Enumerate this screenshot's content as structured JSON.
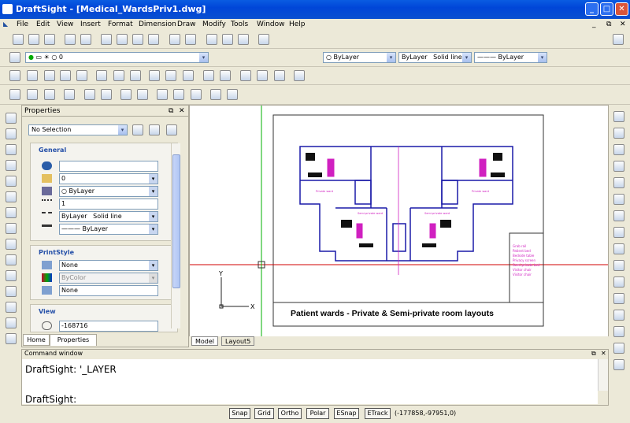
{
  "window": {
    "title": "DraftSight - [Medical_WardsPriv1.dwg]"
  },
  "menu": [
    "File",
    "Edit",
    "View",
    "Insert",
    "Format",
    "Dimension",
    "Draw",
    "Modify",
    "Tools",
    "Window",
    "Help"
  ],
  "layers_bar": {
    "layer_value": "0",
    "color_value": "ByLayer",
    "linestyle_value": "ByLayer",
    "linestyle_name": "Solid line",
    "lineweight_value": "ByLayer"
  },
  "properties": {
    "title": "Properties",
    "selection": "No Selection",
    "general": {
      "heading": "General",
      "layer": "0",
      "color": "ByLayer",
      "linescale": "1",
      "linestyle_value": "ByLayer",
      "linestyle_name": "Solid line",
      "lineweight": "ByLayer"
    },
    "printstyle": {
      "heading": "PrintStyle",
      "style": "None",
      "color": "ByColor",
      "table": "None"
    },
    "view": {
      "heading": "View",
      "center_x": "-168716"
    },
    "tabs": [
      "Home",
      "Properties"
    ]
  },
  "drawing": {
    "title": "Patient wards - Private & Semi-private room layouts",
    "room_labels": [
      "Private ward",
      "Semi-private ward",
      "Semi-private ward",
      "Private ward"
    ],
    "legend_items": [
      "Grab rail",
      "Patient bed",
      "Bedside table",
      "Privacy screen",
      "Semi-private bed",
      "Visitor chair",
      "Visitor chair"
    ],
    "axis_y": "Y",
    "axis_x": "X"
  },
  "canvas_tabs": [
    "Model",
    "Layout5"
  ],
  "command": {
    "title": "Command window",
    "line1": "DraftSight: '_LAYER",
    "prompt": "DraftSight:"
  },
  "status": {
    "buttons": [
      "Snap",
      "Grid",
      "Ortho",
      "Polar",
      "ESnap",
      "ETrack"
    ],
    "coordinates": "(-177858,-97951,0)"
  },
  "colors": {
    "title_bar": "#0046d8",
    "accent_magenta": "#d020c0",
    "wall_blue": "#1a1aa8",
    "cursor_red": "#d00000",
    "cursor_green": "#00b000"
  }
}
